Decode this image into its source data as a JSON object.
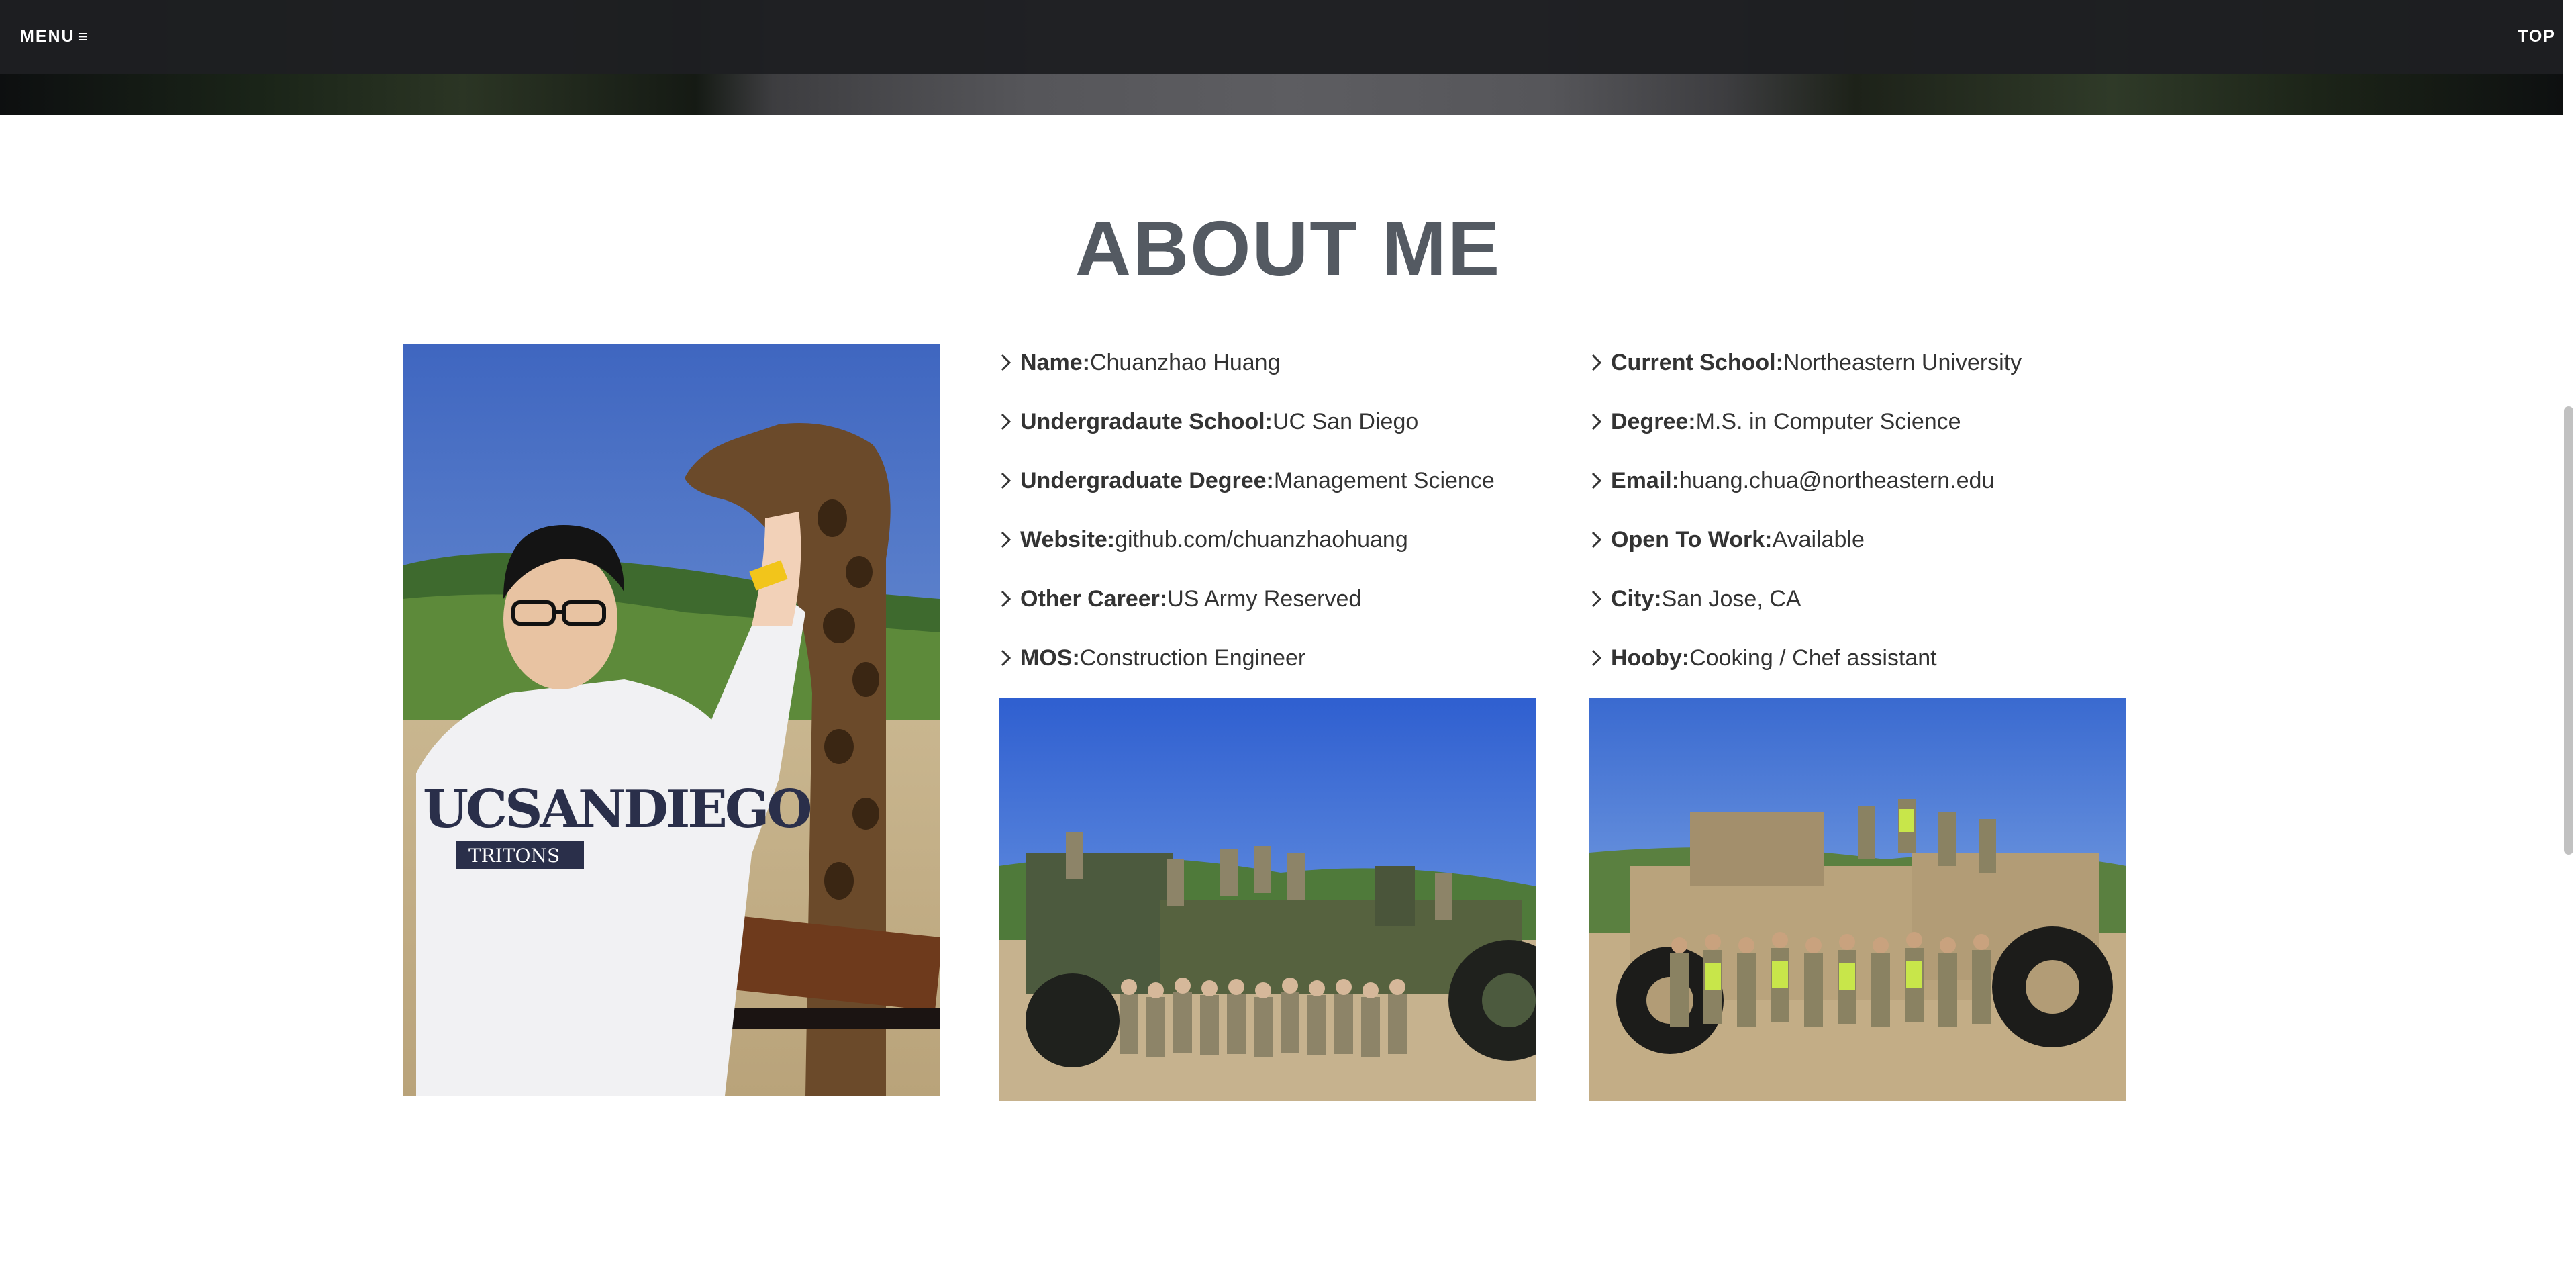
{
  "nav": {
    "menu_label": "MENU",
    "menu_icon": "≡",
    "top_label": "TOP"
  },
  "section": {
    "title": "ABOUT ME"
  },
  "info_left": [
    {
      "label": "Name:",
      "value": "Chuanzhao Huang"
    },
    {
      "label": "Undergradaute School:",
      "value": "UC San Diego"
    },
    {
      "label": "Undergraduate Degree:",
      "value": "Management Science"
    },
    {
      "label": "Website:",
      "value": "github.com/chuanzhaohuang"
    },
    {
      "label": "Other Career:",
      "value": "US Army Reserved"
    },
    {
      "label": "MOS:",
      "value": "Construction Engineer"
    }
  ],
  "info_right": [
    {
      "label": "Current School:",
      "value": "Northeastern University"
    },
    {
      "label": "Degree:",
      "value": "M.S. in Computer Science"
    },
    {
      "label": "Email:",
      "value": "huang.chua@northeastern.edu"
    },
    {
      "label": "Open To Work:",
      "value": "Available"
    },
    {
      "label": "City:",
      "value": "San Jose, CA"
    },
    {
      "label": "Hooby:",
      "value": "Cooking / Chef assistant"
    }
  ],
  "photos": {
    "portrait_sweatshirt_text": "UCSANDIEGO",
    "portrait_sweatshirt_subtext": "TRITONS"
  },
  "colors": {
    "navbar": "#1e1f22",
    "title": "#545a62",
    "text": "#333333"
  }
}
